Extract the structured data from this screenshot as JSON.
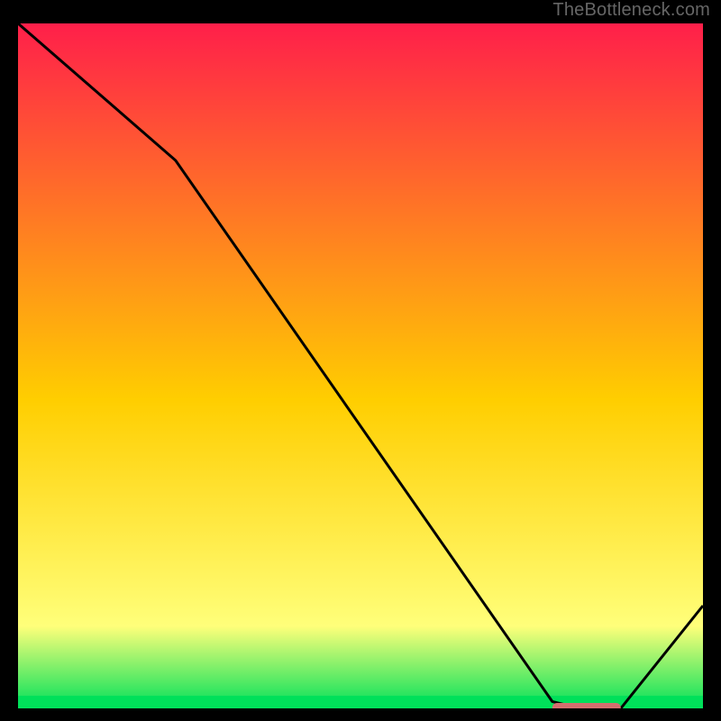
{
  "attribution": "TheBottleneck.com",
  "colors": {
    "top": "#ff1f4a",
    "mid": "#ffce00",
    "lower": "#ffff7a",
    "bottom": "#00e05a",
    "line": "#000000",
    "marker": "#d36e6e",
    "background": "#000000"
  },
  "chart_data": {
    "type": "line",
    "title": "",
    "xlabel": "",
    "ylabel": "",
    "xlim": [
      0,
      100
    ],
    "ylim": [
      0,
      100
    ],
    "x": [
      0,
      23,
      78,
      82,
      88,
      100
    ],
    "values": [
      100,
      80,
      1,
      0,
      0,
      15
    ],
    "annotations": [],
    "marker_band": {
      "x_start": 78,
      "x_end": 88,
      "y": 0
    }
  }
}
